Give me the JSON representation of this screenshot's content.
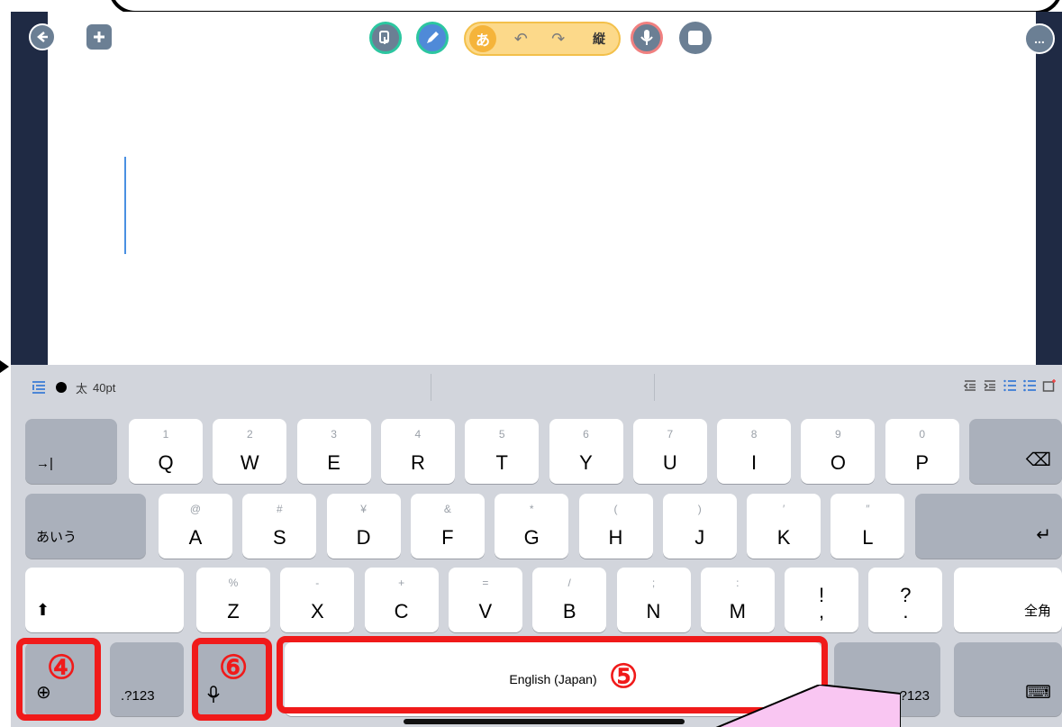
{
  "toolbar": {
    "back_icon": "arrow-left-icon",
    "add_icon": "plus-icon",
    "input_mode": "あ",
    "undo_symbol": "↶",
    "redo_symbol": "↷",
    "vertical_label": "縦",
    "more_label": "..."
  },
  "format_bar": {
    "color_name": "●",
    "weight_label": "太",
    "size_label": "40pt"
  },
  "keyboard": {
    "tab_symbol": "→|",
    "delete_symbol": "⌫",
    "kana_label": "あいう",
    "return_symbol": "↵",
    "shift_symbol": "⬆",
    "zenkaku_label": "全角",
    "globe_symbol": "⊕",
    "numbers_left_label": ".?123",
    "numbers_right_label": ".?123",
    "space_label": "English (Japan)",
    "hide_symbol": "⌨",
    "row1": [
      {
        "hint": "1",
        "key": "Q"
      },
      {
        "hint": "2",
        "key": "W"
      },
      {
        "hint": "3",
        "key": "E"
      },
      {
        "hint": "4",
        "key": "R"
      },
      {
        "hint": "5",
        "key": "T"
      },
      {
        "hint": "6",
        "key": "Y"
      },
      {
        "hint": "7",
        "key": "U"
      },
      {
        "hint": "8",
        "key": "I"
      },
      {
        "hint": "9",
        "key": "O"
      },
      {
        "hint": "0",
        "key": "P"
      }
    ],
    "row2": [
      {
        "hint": "@",
        "key": "A"
      },
      {
        "hint": "#",
        "key": "S"
      },
      {
        "hint": "¥",
        "key": "D"
      },
      {
        "hint": "&",
        "key": "F"
      },
      {
        "hint": "*",
        "key": "G"
      },
      {
        "hint": "(",
        "key": "H"
      },
      {
        "hint": ")",
        "key": "J"
      },
      {
        "hint": "′",
        "key": "K"
      },
      {
        "hint": "″",
        "key": "L"
      }
    ],
    "row3": [
      {
        "hint": "%",
        "key": "Z"
      },
      {
        "hint": "-",
        "key": "X"
      },
      {
        "hint": "+",
        "key": "C"
      },
      {
        "hint": "=",
        "key": "V"
      },
      {
        "hint": "/",
        "key": "B"
      },
      {
        "hint": ";",
        "key": "N"
      },
      {
        "hint": ":",
        "key": "M"
      },
      {
        "hint": "",
        "key": "!\n,"
      },
      {
        "hint": "",
        "key": "?\n."
      }
    ]
  },
  "annotations": {
    "globe_marker": "④",
    "space_marker": "⑤",
    "mic_marker": "⑥",
    "highlight_color": "#f01a1a"
  }
}
